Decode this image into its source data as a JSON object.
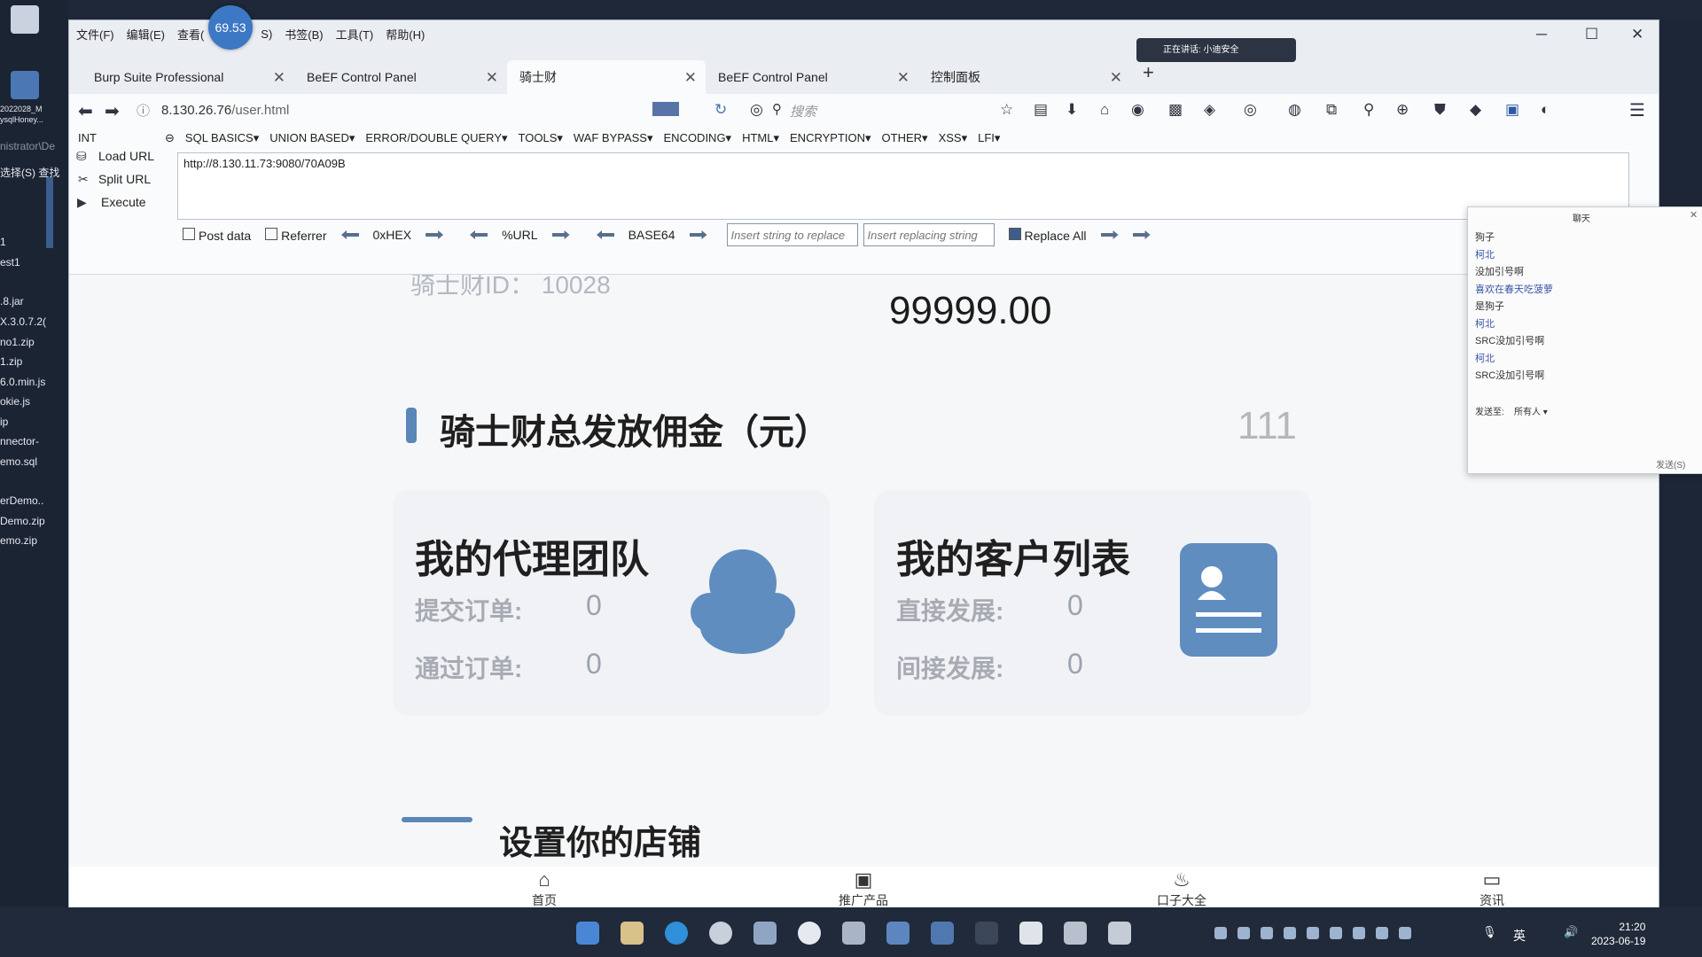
{
  "menu": [
    "文件(F)",
    "编辑(E)",
    "查看(",
    "S)",
    "书签(B)",
    "工具(T)",
    "帮助(H)"
  ],
  "badge": "69.53",
  "sharing": "正在讲话: 小迪安全",
  "tabs": [
    {
      "label": "Burp Suite Professional"
    },
    {
      "label": "BeEF Control Panel"
    },
    {
      "label": "骑士财",
      "active": true
    },
    {
      "label": "BeEF Control Panel"
    },
    {
      "label": "控制面板"
    }
  ],
  "nav": {
    "url_host": "8.130.26.76",
    "url_path": "/user.html",
    "search_placeholder": "搜索"
  },
  "hackbar": {
    "type_select": "INT",
    "menu": [
      "SQL BASICS▾",
      "UNION BASED▾",
      "ERROR/DOUBLE QUERY▾",
      "TOOLS▾",
      "WAF BYPASS▾",
      "ENCODING▾",
      "HTML▾",
      "ENCRYPTION▾",
      "OTHER▾",
      "XSS▾",
      "LFI▾"
    ],
    "load_url": "Load URL",
    "split_url": "Split URL",
    "execute": "Execute",
    "url_value": "http://8.130.11.73:9080/70A09B",
    "post_data": "Post data",
    "referrer": "Referrer",
    "hex": "0xHEX",
    "url_enc": "%URL",
    "base64": "BASE64",
    "insert_placeholder": "Insert string to replace",
    "replacing_placeholder": "Insert replacing string",
    "replace_all": "Replace All"
  },
  "page": {
    "user_id": "骑士财ID：  10028",
    "balance": "99999.00",
    "commission_title": "骑士财总发放佣金（元）",
    "commission_value": "111",
    "team": {
      "title": "我的代理团队",
      "submitted_label": "提交订单:",
      "submitted": "0",
      "passed_label": "通过订单:",
      "passed": "0"
    },
    "customers": {
      "title": "我的客户列表",
      "direct_label": "直接发展:",
      "direct": "0",
      "indirect_label": "间接发展:",
      "indirect": "0"
    },
    "partial_heading": "设置你的店铺",
    "bottom_nav": [
      "首页",
      "推广产品",
      "口子大全",
      "资讯"
    ]
  },
  "chat": {
    "title": "聊天",
    "messages": [
      "狗子",
      "柯北",
      "没加引号啊",
      "喜欢在春天吃菠萝",
      "是狗子",
      "柯北",
      "SRC没加引号啊",
      "柯北",
      "SRC没加引号啊"
    ],
    "send_to_label": "发送至:",
    "send_to_value": "所有人 ▾",
    "send_button": "发送(S)"
  },
  "desktop": {
    "files": [
      "2022028_M",
      "ysqlHoney...",
      "nistrator\\De",
      "选择(S)  查找",
      "1",
      "est1",
      ".8.jar",
      "X.3.0.7.2(",
      "no1.zip",
      "1.zip",
      "6.0.min.js",
      "okie.js",
      "ip",
      "nnector-",
      "emo.sql",
      "erDemo..",
      "Demo.zip",
      "emo.zip"
    ]
  },
  "taskbar": {
    "time": "21:20",
    "date": "2023-06-19",
    "lang": "英"
  }
}
